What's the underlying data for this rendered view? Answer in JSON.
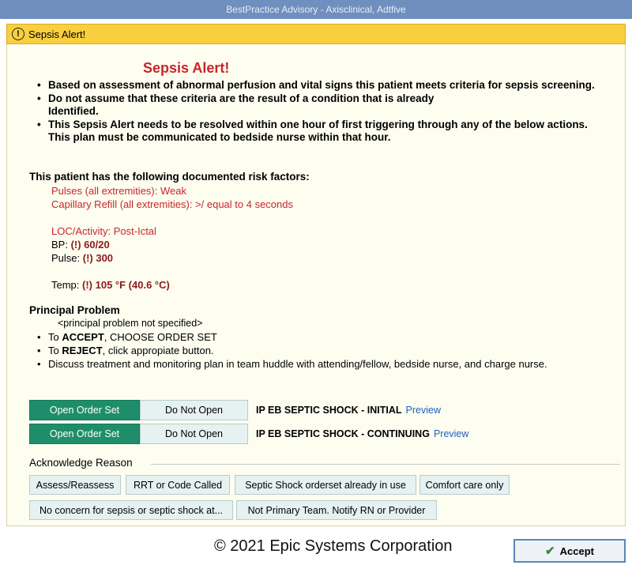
{
  "window": {
    "title": "BestPractice Advisory - Axisclinical, Adtfive"
  },
  "alert_header": {
    "icon": "warning-circle-icon",
    "label": "Sepsis Alert!"
  },
  "alert_title": "Sepsis Alert!",
  "criteria": [
    "Based on assessment of abnormal perfusion and vital signs this patient meets criteria for sepsis screening.",
    "Do not assume that these criteria are the result of a condition that is already Identified.",
    "This Sepsis Alert needs to be resolved within one hour of first triggering through any of the below actions. This plan must be communicated to bedside nurse within that hour."
  ],
  "risk": {
    "title": "This patient has the following documented risk factors:",
    "pulses": "Pulses (all extremities): Weak",
    "cap_refill": "Capillary Refill (all extremities): >/ equal to 4 seconds",
    "loc": "LOC/Activity: Post-Ictal",
    "bp_label": "BP: ",
    "bp_value": "(!) 60/20",
    "pulse_label": "Pulse: ",
    "pulse_value": "(!) 300",
    "temp_label": "Temp: ",
    "temp_value": "(!) 105 °F (40.6 °C)"
  },
  "principal_problem": {
    "title": "Principal Problem",
    "value": "<principal problem not specified>"
  },
  "actions": {
    "accept_prefix": "To ",
    "accept_bold": "ACCEPT",
    "accept_suffix": ", CHOOSE ORDER SET",
    "reject_prefix": "To ",
    "reject_bold": "REJECT",
    "reject_suffix": ", click appropiate button.",
    "discuss": "Discuss treatment and monitoring plan in team huddle with attending/fellow, bedside nurse, and charge nurse."
  },
  "order_sets": [
    {
      "open_label": "Open Order Set",
      "noopen_label": "Do Not Open",
      "name": "IP EB SEPTIC SHOCK - INITIAL",
      "preview": "Preview"
    },
    {
      "open_label": "Open Order Set",
      "noopen_label": "Do Not Open",
      "name": "IP EB SEPTIC SHOCK - CONTINUING",
      "preview": "Preview"
    }
  ],
  "acknowledge": {
    "label": "Acknowledge Reason",
    "reasons": [
      "Assess/Reassess",
      "RRT or Code Called",
      "Septic Shock orderset already in use",
      "Comfort care only",
      "No concern for sepsis or septic shock at...",
      "Not Primary Team. Notify RN or Provider"
    ]
  },
  "footer": {
    "copyright": "© 2021 Epic Systems Corporation",
    "accept_label": "Accept",
    "accept_icon": "checkmark-icon"
  },
  "colors": {
    "title_bar": "#6f8fbf",
    "alert_yellow": "#f8cf3e",
    "alert_red": "#c8262b",
    "open_green": "#1e8e6a",
    "link_blue": "#1f5fc0"
  }
}
